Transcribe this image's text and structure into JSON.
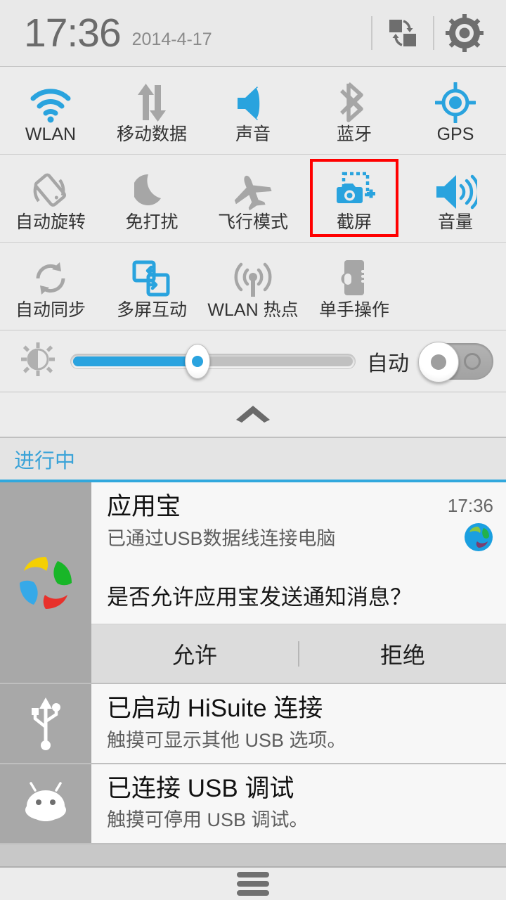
{
  "statusbar": {
    "time": "17:36",
    "date": "2014-4-17",
    "switch_user_icon": "user-switch-icon",
    "settings_icon": "gear-icon"
  },
  "quick_settings": {
    "rows": [
      [
        {
          "label": "WLAN",
          "icon": "wifi-icon",
          "active": true
        },
        {
          "label": "移动数据",
          "icon": "mobile-data-icon",
          "active": false
        },
        {
          "label": "声音",
          "icon": "sound-icon",
          "active": true
        },
        {
          "label": "蓝牙",
          "icon": "bluetooth-icon",
          "active": false
        },
        {
          "label": "GPS",
          "icon": "gps-icon",
          "active": true
        }
      ],
      [
        {
          "label": "自动旋转",
          "icon": "auto-rotate-icon",
          "active": false
        },
        {
          "label": "免打扰",
          "icon": "do-not-disturb-icon",
          "active": false
        },
        {
          "label": "飞行模式",
          "icon": "airplane-mode-icon",
          "active": false
        },
        {
          "label": "截屏",
          "icon": "screenshot-icon",
          "active": true,
          "highlighted": true
        },
        {
          "label": "音量",
          "icon": "volume-icon",
          "active": true
        }
      ],
      [
        {
          "label": "自动同步",
          "icon": "auto-sync-icon",
          "active": false
        },
        {
          "label": "多屏互动",
          "icon": "multi-screen-icon",
          "active": true
        },
        {
          "label": "WLAN 热点",
          "icon": "hotspot-icon",
          "active": false
        },
        {
          "label": "单手操作",
          "icon": "one-hand-mode-icon",
          "active": false
        }
      ]
    ]
  },
  "brightness": {
    "icon": "brightness-icon",
    "value_percent": 43,
    "auto_label": "自动",
    "auto_enabled": false
  },
  "collapse": {
    "icon": "chevron-up-icon"
  },
  "ongoing": {
    "title": "进行中"
  },
  "notifications": [
    {
      "app_icon": "tencent-myapp-logo",
      "title": "应用宝",
      "subtitle": "已通过USB数据线连接电脑",
      "time": "17:36",
      "badge_icon": "app-badge-icon",
      "prompt": "是否允许应用宝发送通知消息？",
      "actions": [
        "允许",
        "拒绝"
      ]
    },
    {
      "app_icon": "usb-icon",
      "title": "已启动 HiSuite 连接",
      "subtitle": "触摸可显示其他 USB 选项。"
    },
    {
      "app_icon": "android-bugdroid-icon",
      "title": "已连接 USB 调试",
      "subtitle": "触摸可停用 USB 调试。"
    }
  ],
  "footer": {
    "handle_icon": "drag-handle-icon"
  },
  "colors": {
    "accent_blue": "#2aa3df",
    "inactive_gray": "#a6a6a6",
    "highlight_red": "#ff0000",
    "panel_bg": "#ececec"
  }
}
